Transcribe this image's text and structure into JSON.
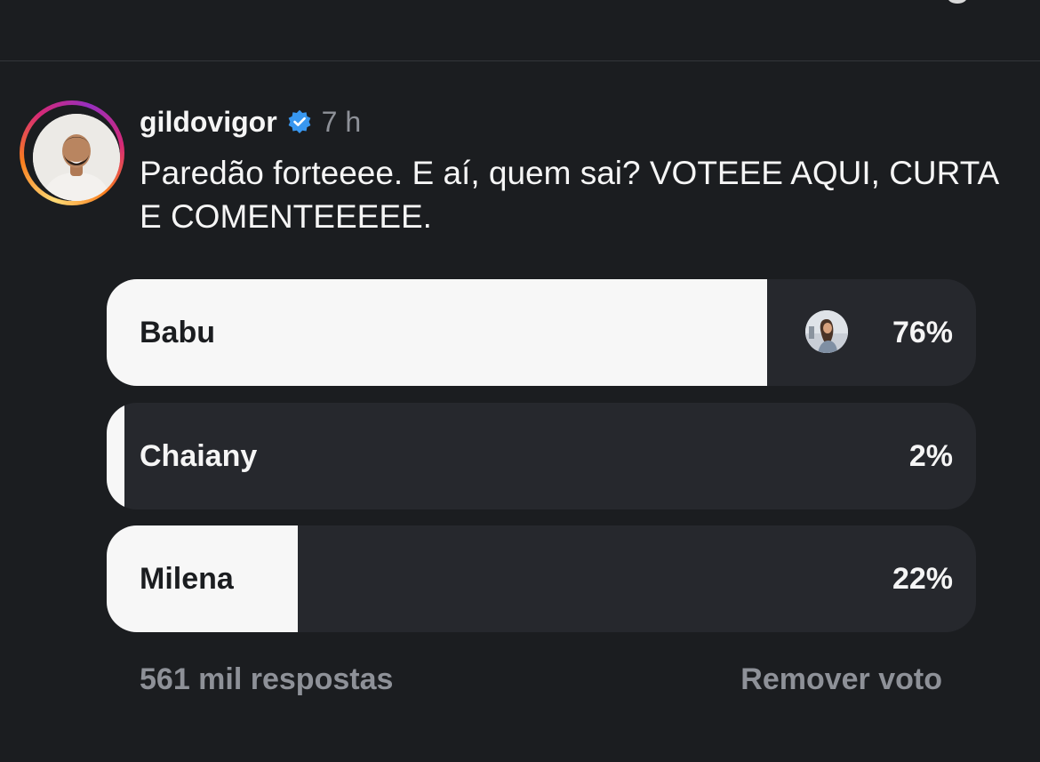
{
  "post": {
    "username": "gildovigor",
    "verified": true,
    "time": "7 h",
    "caption": "Paredão forteeee. E aí, quem sai? VOTEEE AQUI, CURTA E COMENTEEEEE."
  },
  "poll": {
    "options": [
      {
        "label": "Babu",
        "percent_label": "76%",
        "percent": 76,
        "voted": true,
        "shows_voter_avatar": true
      },
      {
        "label": "Chaiany",
        "percent_label": "2%",
        "percent": 2,
        "voted": false,
        "shows_voter_avatar": false
      },
      {
        "label": "Milena",
        "percent_label": "22%",
        "percent": 22,
        "voted": false,
        "shows_voter_avatar": false
      }
    ],
    "responses": "561 mil respostas",
    "remove_vote_label": "Remover voto"
  },
  "colors": {
    "background": "#1b1d20",
    "bar_track": "#26282d",
    "bar_fill": "#f7f7f7",
    "muted_text": "#8e9198",
    "verified_badge": "#3897f0"
  },
  "icons": {
    "verified": "verified-badge-icon"
  }
}
